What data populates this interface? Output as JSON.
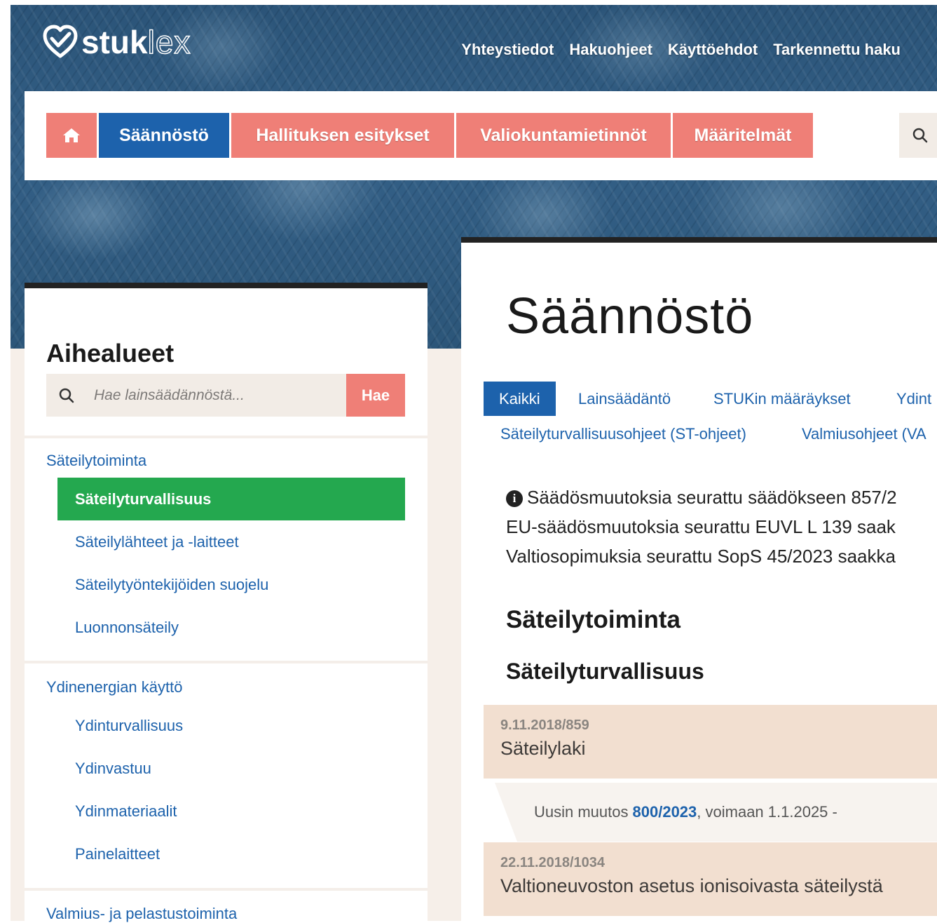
{
  "header": {
    "logo": {
      "strong": "stuk",
      "light": "lex"
    },
    "top_links": [
      "Yhteystiedot",
      "Hakuohjeet",
      "Käyttöehdot",
      "Tarkennettu haku"
    ]
  },
  "nav": {
    "home_icon": "home-icon",
    "items": [
      "Säännöstö",
      "Hallituksen esitykset",
      "Valiokuntamietinnöt",
      "Määritelmät"
    ],
    "active": "Säännöstö",
    "search_icon": "search-icon"
  },
  "sidebar": {
    "title": "Aihealueet",
    "search": {
      "placeholder": "Hae lainsäädännöstä...",
      "button": "Hae"
    },
    "groups": [
      {
        "label": "Säteilytoiminta",
        "items": [
          "Säteilyturvallisuus",
          "Säteilylähteet ja -laitteet",
          "Säteilytyöntekijöiden suojelu",
          "Luonnonsäteily"
        ],
        "active_item": "Säteilyturvallisuus"
      },
      {
        "label": "Ydinenergian käyttö",
        "items": [
          "Ydinturvallisuus",
          "Ydinvastuu",
          "Ydinmateriaalit",
          "Painelaitteet"
        ]
      },
      {
        "label": "Valmius- ja pelastustoiminta",
        "items": []
      }
    ]
  },
  "main": {
    "title": "Säännöstö",
    "tabs_row1": [
      "Kaikki",
      "Lainsäädäntö",
      "STUKin määräykset",
      "Ydint"
    ],
    "tabs_row2": [
      "Säteilyturvallisuusohjeet (ST-ohjeet)",
      "Valmiusohjeet (VA"
    ],
    "active_tab": "Kaikki",
    "info_lines": [
      "Säädösmuutoksia seurattu säädökseen 857/2",
      "EU-säädösmuutoksia seurattu EUVL L 139 saak",
      "Valtiosopimuksia seurattu SopS 45/2023 saakka"
    ],
    "section_heading": "Säteilytoiminta",
    "subsection_heading": "Säteilyturvallisuus",
    "documents": [
      {
        "id": "9.11.2018/859",
        "name": "Säteilylaki",
        "change": {
          "prefix": "Uusin muutos",
          "link": "800/2023",
          "suffix": ", voimaan 1.1.2025 -"
        }
      },
      {
        "id": "22.11.2018/1034",
        "name": "Valtioneuvoston asetus ionisoivasta säteilystä"
      }
    ]
  },
  "colors": {
    "brand_blue": "#1d62ac",
    "nav_salmon": "#ef7f77",
    "active_green": "#24a84f",
    "card_beige": "#f2dfd0"
  }
}
